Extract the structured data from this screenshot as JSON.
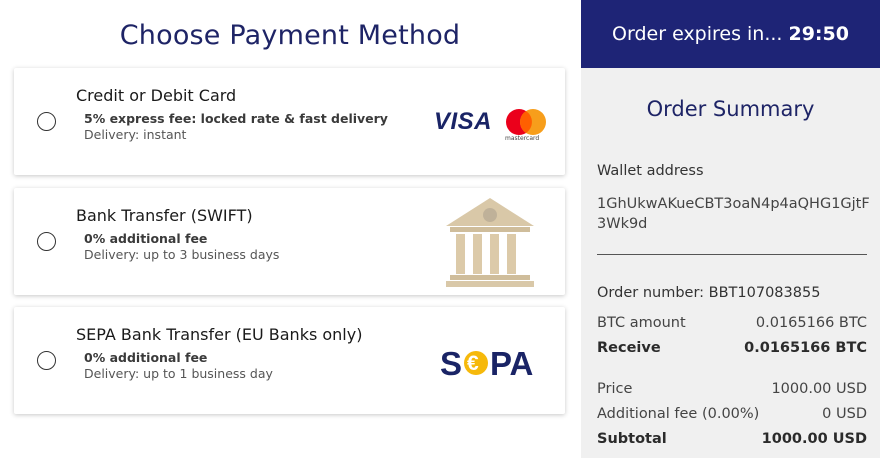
{
  "page_title": "Choose Payment Method",
  "methods": [
    {
      "title": "Credit or Debit Card",
      "fee": "5% express fee: locked rate & fast delivery",
      "delivery": "Delivery: instant",
      "logo_visa": "VISA",
      "logo_mc": "mastercard"
    },
    {
      "title": "Bank Transfer (SWIFT)",
      "fee": "0% additional fee",
      "delivery": "Delivery: up to 3 business days"
    },
    {
      "title": "SEPA Bank Transfer (EU Banks only)",
      "fee": "0% additional fee",
      "delivery": "Delivery: up to 1 business day",
      "logo_sepa": "SEPA"
    }
  ],
  "expiry": {
    "label": "Order expires in...",
    "timer": "29:50"
  },
  "summary": {
    "title": "Order Summary",
    "wallet_label": "Wallet address",
    "wallet_value": "1GhUkwAKueCBT3oaN4p4aQHG1GjtF3Wk9d",
    "order_number": "Order number: BBT107083855",
    "rows": [
      {
        "label": "BTC amount",
        "value": "0.0165166 BTC"
      },
      {
        "label": "Receive",
        "value": "0.0165166 BTC"
      },
      {
        "label": "Price",
        "value": "1000.00 USD"
      },
      {
        "label": "Additional fee (0.00%)",
        "value": "0 USD"
      },
      {
        "label": "Subtotal",
        "value": "1000.00 USD"
      }
    ]
  },
  "colors": {
    "navy": "#1e2476",
    "mc_red": "#eb001b",
    "mc_orange": "#f79e1b",
    "sepa_yellow": "#f6b90b",
    "bank_beige": "#d9c8a8"
  },
  "icons": [
    "radio-icon",
    "visa-logo",
    "mastercard-logo",
    "bank-icon",
    "sepa-logo"
  ]
}
